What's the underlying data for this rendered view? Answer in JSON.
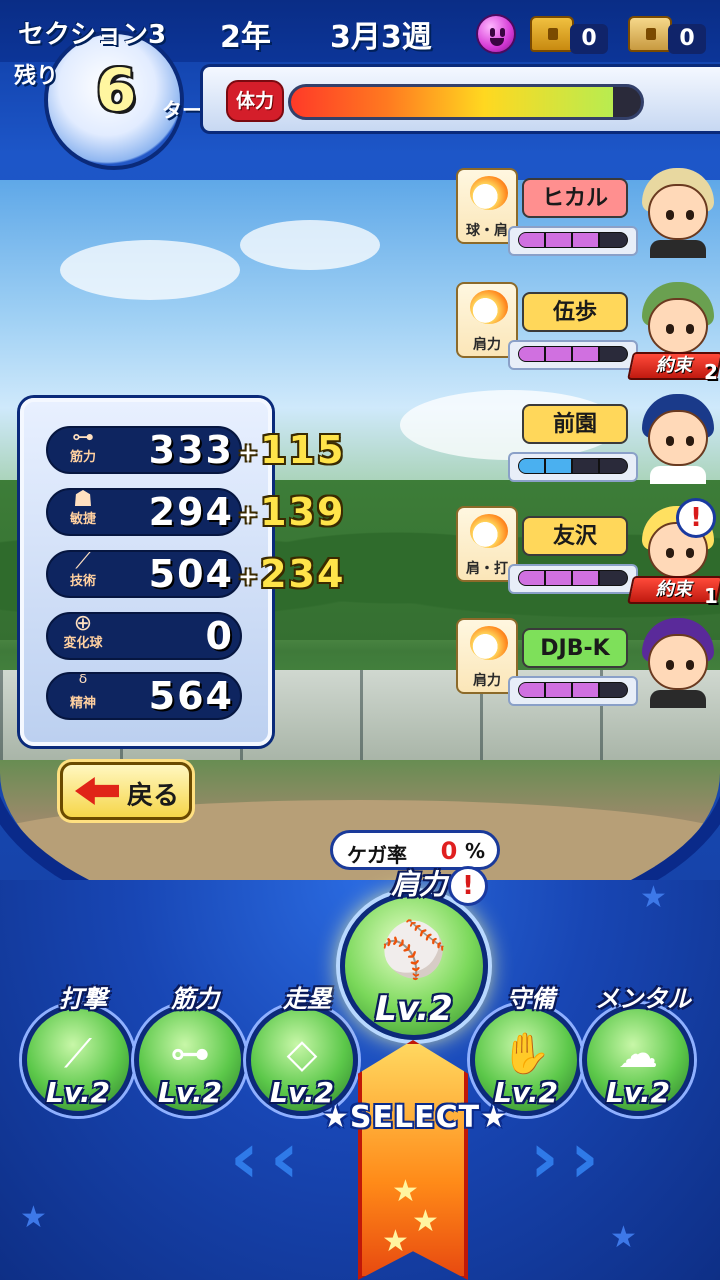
{
  "header": {
    "section": "セクション3",
    "remaining_label": "残り",
    "turns_left": "6",
    "turn_label": "ターン",
    "year": "2年",
    "date": "3月3週",
    "chest_gold_count": "0",
    "chest_silver_count": "0",
    "stamina_label": "体力",
    "stamina_fraction": 0.92,
    "mood_icon": "smiling-face-icon"
  },
  "partners": [
    {
      "name": "ヒカル",
      "skill": "球・肩",
      "name_color": "#ff8f8f",
      "has_skill": true,
      "gauge_color": "#d070e0",
      "gauge_fill": 0.75
    },
    {
      "name": "伍歩",
      "skill": "肩力",
      "name_color": "#ffd75a",
      "has_skill": true,
      "gauge_color": "#d070e0",
      "gauge_fill": 0.75,
      "promise": "約束",
      "promise_count": "2"
    },
    {
      "name": "前園",
      "name_color": "#ffd75a",
      "has_skill": false,
      "gauge_color": "#4ab0f0",
      "gauge_fill": 0.5
    },
    {
      "name": "友沢",
      "skill": "肩・打",
      "name_color": "#ffd75a",
      "has_skill": true,
      "gauge_color": "#d070e0",
      "gauge_fill": 0.75,
      "promise": "約束",
      "promise_count": "1"
    },
    {
      "name": "DJB-K",
      "skill": "肩力",
      "name_color": "#7ee05a",
      "has_skill": true,
      "gauge_color": "#d070e0",
      "gauge_fill": 0.75
    }
  ],
  "stats": [
    {
      "label": "筋力",
      "value": "333",
      "plus": "115"
    },
    {
      "label": "敏捷",
      "value": "294",
      "plus": "139"
    },
    {
      "label": "技術",
      "value": "504",
      "plus": "234"
    },
    {
      "label": "変化球",
      "value": "0",
      "plus": ""
    },
    {
      "label": "精神",
      "value": "564",
      "plus": ""
    }
  ],
  "back_label": "戻る",
  "injury": {
    "label": "ケガ率",
    "value": "0",
    "unit": "%"
  },
  "trainings": [
    {
      "name": "打撃",
      "level": "Lv.2",
      "icon": "bat-icon"
    },
    {
      "name": "筋力",
      "level": "Lv.2",
      "icon": "dumbbell-icon"
    },
    {
      "name": "走塁",
      "level": "Lv.2",
      "icon": "base-icon"
    },
    {
      "name": "肩力",
      "level": "Lv.2",
      "icon": "ball-icon",
      "selected": true
    },
    {
      "name": "守備",
      "level": "Lv.2",
      "icon": "glove-icon"
    },
    {
      "name": "メンタル",
      "level": "Lv.2",
      "icon": "sparkle-cloud-icon"
    }
  ],
  "select_label": "SELECT",
  "colors": {
    "accent": "#ffe44a",
    "danger": "#e02020",
    "frame": "#0a2a7a"
  }
}
